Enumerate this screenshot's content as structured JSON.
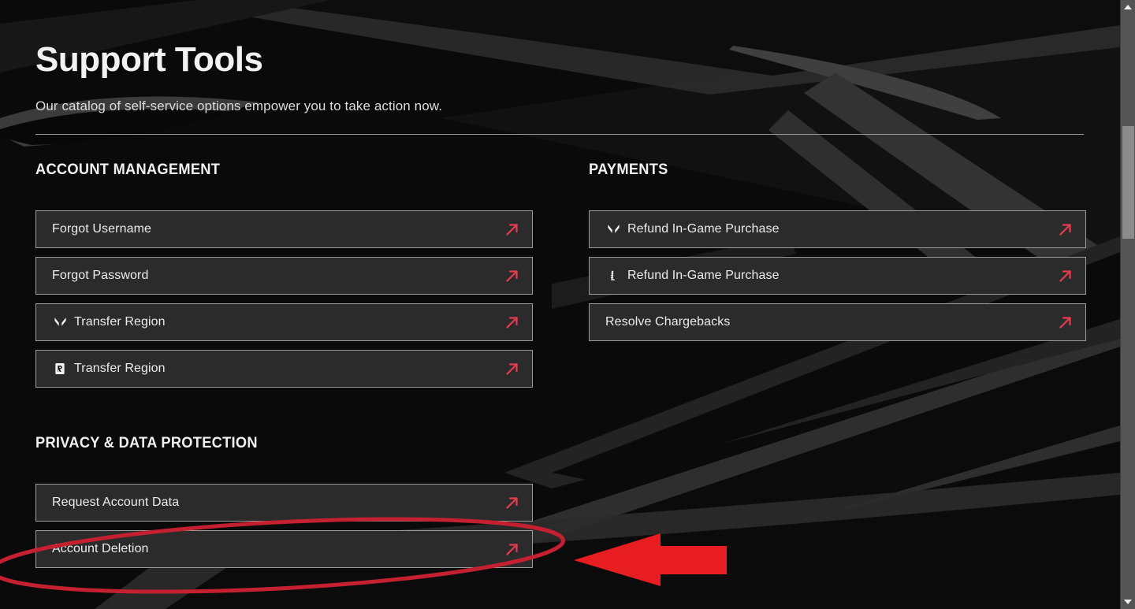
{
  "header": {
    "title": "Support Tools",
    "subtitle": "Our catalog of self-service options empower you to take action now."
  },
  "colors": {
    "page_background": "#0a0a0a",
    "button_background": "#2b2b2b",
    "button_border": "#9c9c9c",
    "text": "#ececec",
    "accent_arrow": "#e23c4e",
    "annotation_red": "#e01b24",
    "annotation_ellipse": "#c42030",
    "scrollbar_track": "#545454",
    "scrollbar_thumb": "#8c8c8c"
  },
  "columns": {
    "left": [
      {
        "heading": "ACCOUNT MANAGEMENT",
        "items": [
          {
            "label": "Forgot Username",
            "icon": null,
            "arrow_icon": "external-link-arrow-icon"
          },
          {
            "label": "Forgot Password",
            "icon": null,
            "arrow_icon": "external-link-arrow-icon"
          },
          {
            "label": "Transfer Region",
            "icon": "valorant-logo-icon",
            "arrow_icon": "external-link-arrow-icon"
          },
          {
            "label": "Transfer Region",
            "icon": "riot-games-logo-icon",
            "arrow_icon": "external-link-arrow-icon"
          }
        ]
      },
      {
        "heading": "PRIVACY & DATA PROTECTION",
        "items": [
          {
            "label": "Request Account Data",
            "icon": null,
            "arrow_icon": "external-link-arrow-icon"
          },
          {
            "label": "Account Deletion",
            "icon": null,
            "arrow_icon": "external-link-arrow-icon"
          }
        ]
      }
    ],
    "right": [
      {
        "heading": "PAYMENTS",
        "items": [
          {
            "label": "Refund In-Game Purchase",
            "icon": "valorant-logo-icon",
            "arrow_icon": "external-link-arrow-icon"
          },
          {
            "label": "Refund In-Game Purchase",
            "icon": "league-of-legends-logo-icon",
            "arrow_icon": "external-link-arrow-icon"
          },
          {
            "label": "Resolve Chargebacks",
            "icon": null,
            "arrow_icon": "external-link-arrow-icon"
          }
        ]
      }
    ]
  },
  "annotations": {
    "ellipse": {
      "target": "Account Deletion",
      "shape": "ellipse-highlight"
    },
    "arrow": {
      "direction": "left",
      "shape": "pointer-arrow"
    }
  },
  "scrollbar": {
    "up_icon": "chevron-up-icon",
    "down_icon": "chevron-down-icon",
    "orientation": "vertical"
  }
}
